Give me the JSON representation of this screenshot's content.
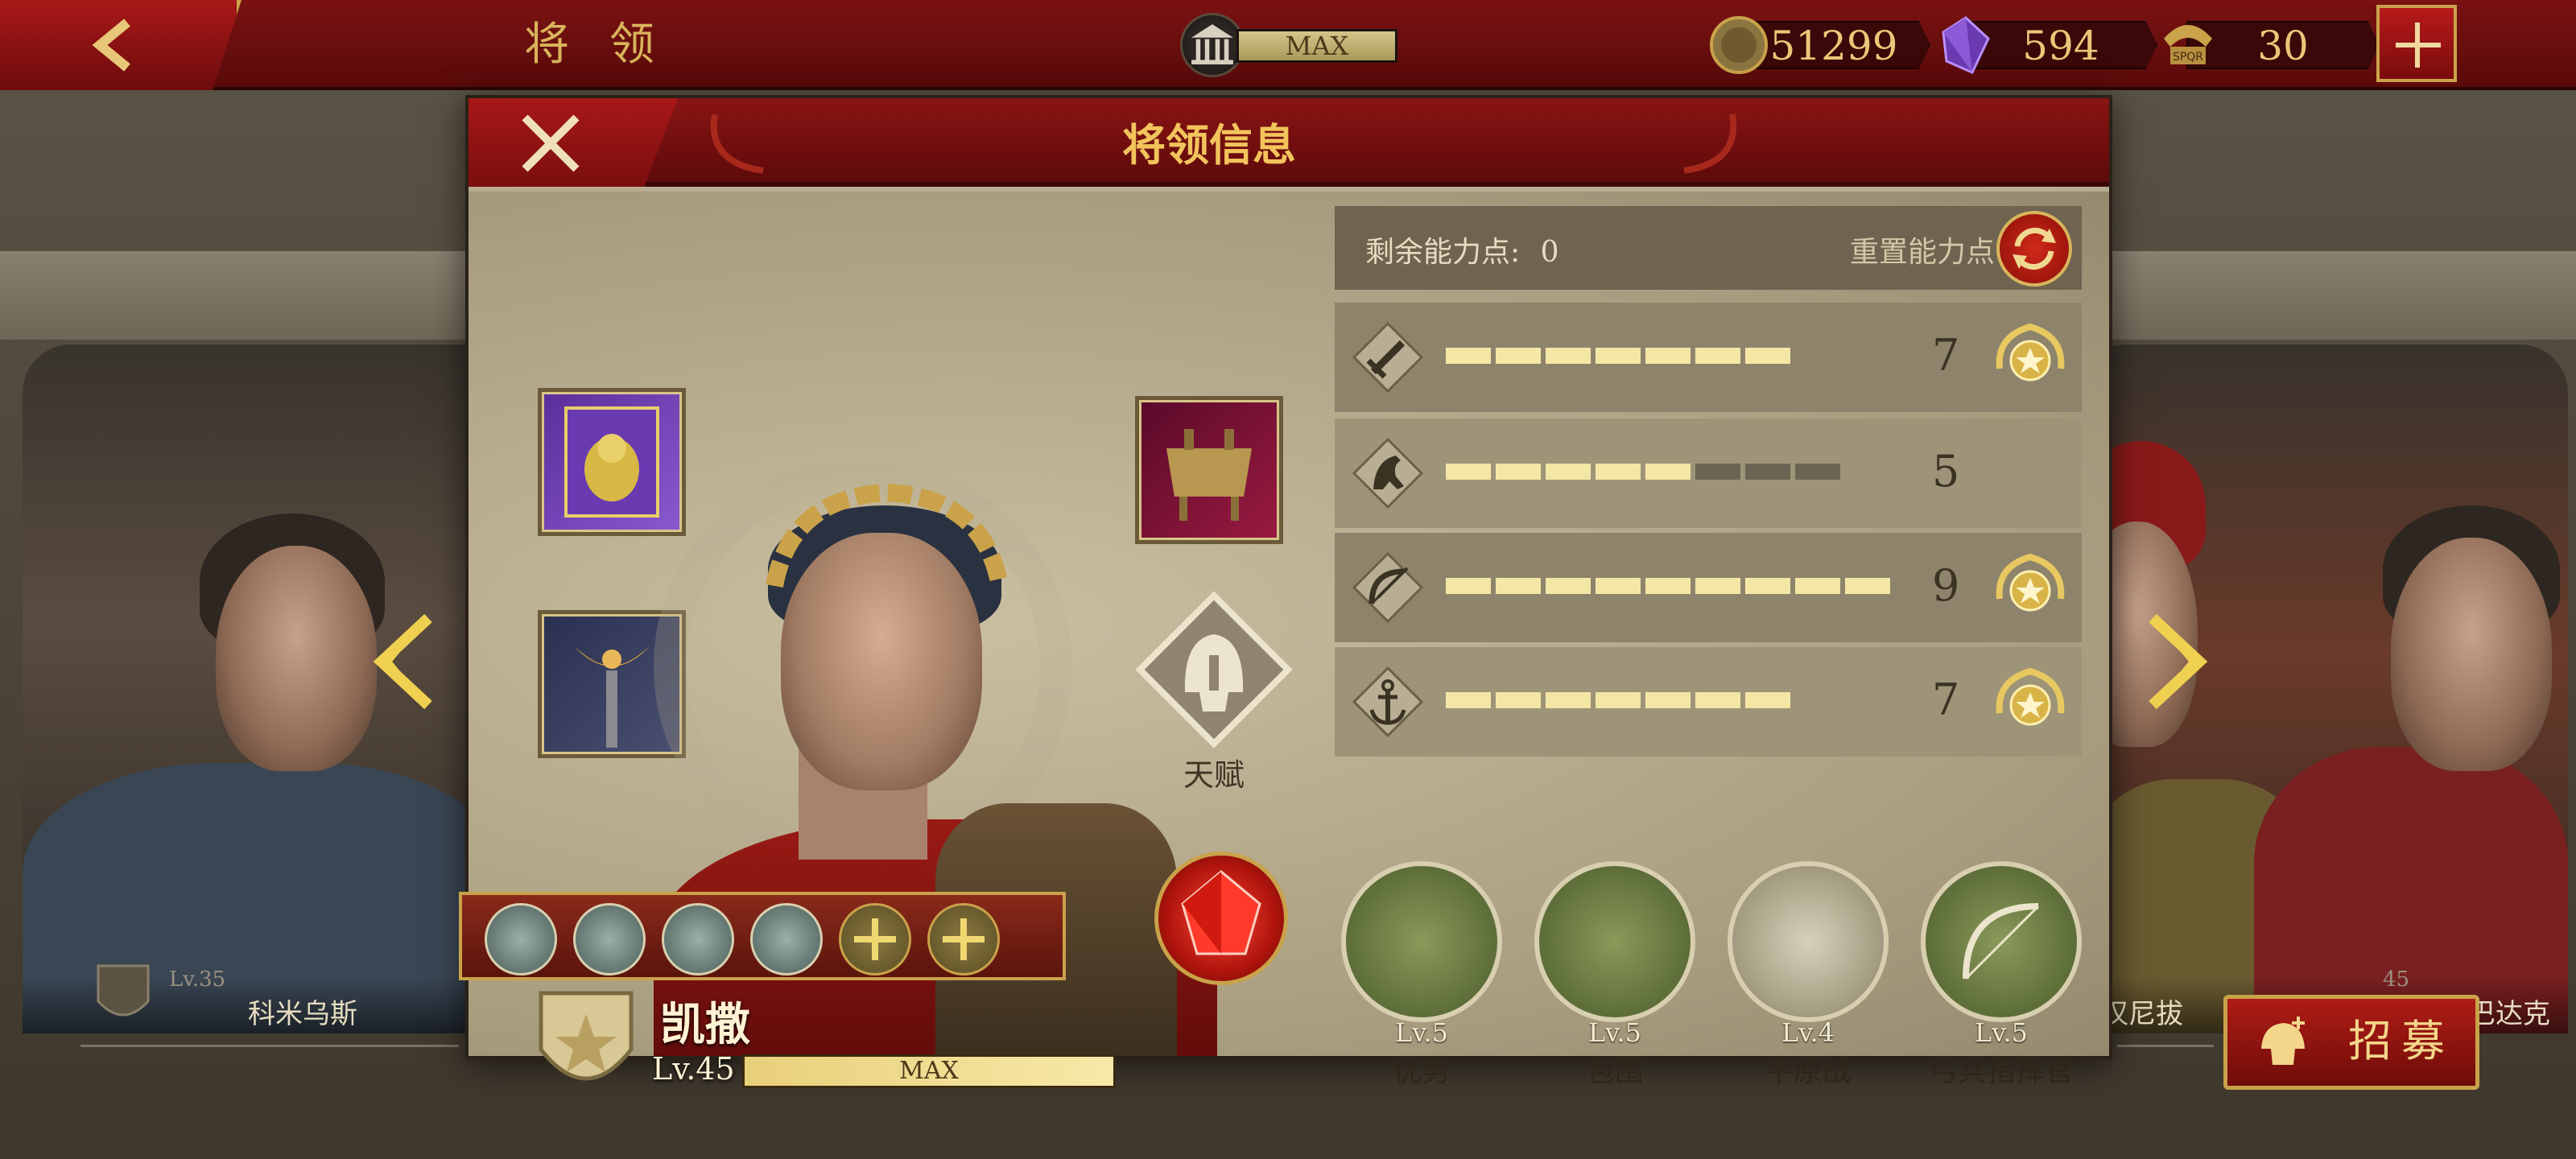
{
  "topbar": {
    "title": "将 领",
    "max_label": "MAX",
    "resources": [
      {
        "name": "gold",
        "icon": "coin-icon",
        "value": "51299"
      },
      {
        "name": "gems",
        "icon": "gem-icon",
        "value": "594"
      },
      {
        "name": "spqr",
        "icon": "spqr-standard-icon",
        "value": "30"
      }
    ]
  },
  "gallery": {
    "left_hero": {
      "name": "科米乌斯",
      "level": "Lv.35"
    },
    "right_hero_1": {
      "name": "汉尼拔"
    },
    "right_hero_2": {
      "name": "斯巴达克",
      "level_fragment": "45"
    },
    "recruit_label": "招募"
  },
  "dialog": {
    "title": "将领信息",
    "talent_label": "天赋",
    "hero": {
      "name": "凯撒",
      "level": "Lv.45",
      "xp_label": "MAX"
    },
    "ability": {
      "remaining_label": "剩余能力点:",
      "remaining_value": "0",
      "reset_label": "重置能力点"
    },
    "stats": [
      {
        "key": "infantry",
        "icon": "sword-icon",
        "value": "7",
        "filled": 7,
        "total": 7,
        "medal": true
      },
      {
        "key": "cavalry",
        "icon": "horse-icon",
        "value": "5",
        "filled": 5,
        "total": 8,
        "medal": false
      },
      {
        "key": "archery",
        "icon": "bow-icon",
        "value": "9",
        "filled": 9,
        "total": 9,
        "medal": true
      },
      {
        "key": "navy",
        "icon": "anchor-icon",
        "value": "7",
        "filled": 7,
        "total": 7,
        "medal": true
      }
    ],
    "tactics": [
      {
        "level": "Lv.5",
        "name": "优势"
      },
      {
        "level": "Lv.5",
        "name": "包围"
      },
      {
        "level": "Lv.4",
        "name": "平原战"
      },
      {
        "level": "Lv.5",
        "name": "弓兵指挥官"
      }
    ]
  },
  "colors": {
    "accent_red": "#8a1414",
    "gold": "#f2c45c",
    "bar_on": "#f4e7a6"
  }
}
